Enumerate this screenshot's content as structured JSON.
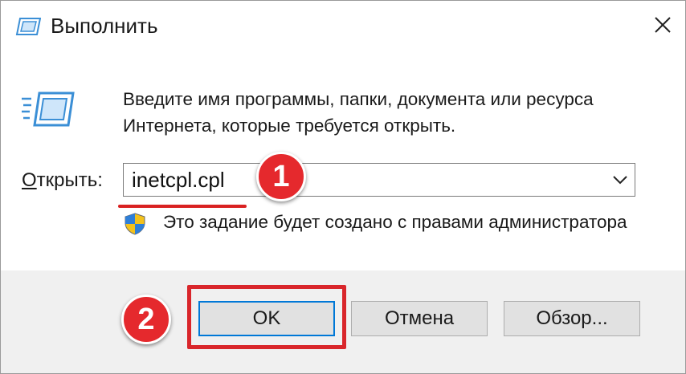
{
  "window": {
    "title": "Выполнить",
    "icon": "run-icon",
    "close_icon": "close-icon"
  },
  "description": {
    "line1": "Введите имя программы, папки, документа или ресурса",
    "line2": "Интернета, которые требуется открыть."
  },
  "open_field": {
    "label_prefix": "О",
    "label_rest": "ткрыть:",
    "value": "inetcpl.cpl",
    "dropdown_icon": "chevron-down-icon"
  },
  "admin_note": {
    "icon": "shield-icon",
    "text": "Это задание будет создано с правами администратора"
  },
  "buttons": {
    "ok": "OK",
    "cancel": "Отмена",
    "browse": "Обзор..."
  },
  "annotations": {
    "step1": "1",
    "step2": "2",
    "accent_color": "#e5292d"
  }
}
